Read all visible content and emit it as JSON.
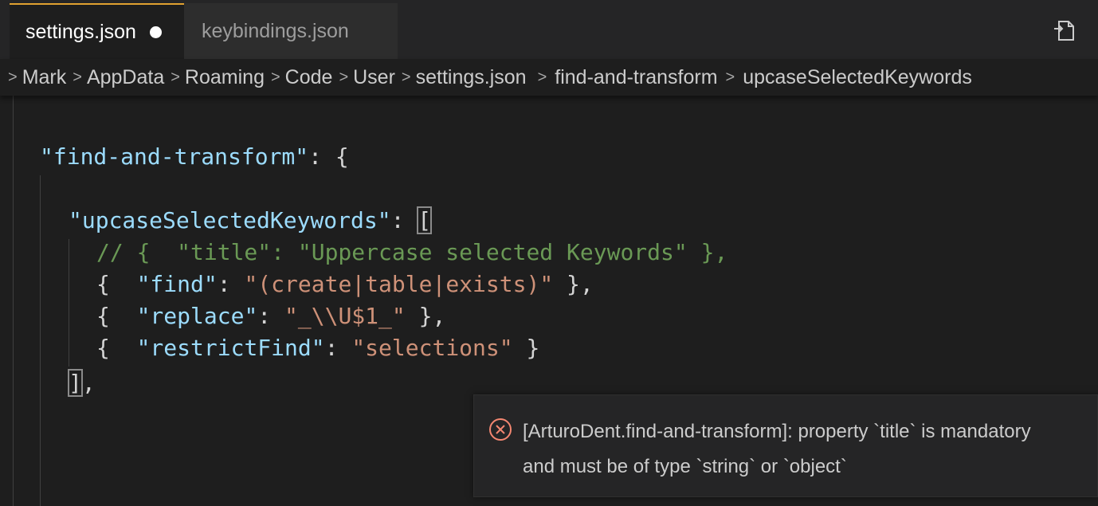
{
  "tabs": [
    {
      "label": "settings.json",
      "active": true,
      "dirty": true
    },
    {
      "label": "keybindings.json",
      "active": false,
      "dirty": false
    }
  ],
  "icons": {
    "open_changes": "open-changes-icon",
    "separator": "chevron-right-icon",
    "error": "error-circle-x-icon",
    "dirty": "unsaved-dot-icon"
  },
  "breadcrumbs": [
    "Mark",
    "AppData",
    "Roaming",
    "Code",
    "User",
    "settings.json",
    "find-and-transform",
    "upcaseSelectedKeywords"
  ],
  "editor": {
    "lines": {
      "l1_key": "\"find-and-transform\"",
      "l1_rest": ": {",
      "l2_key": "\"upcaseSelectedKeywords\"",
      "l2_colon": ": ",
      "l2_bracket": "[",
      "l3_comment": "// {  \"title\": \"Uppercase selected Keywords\" },",
      "l4_open": "{  ",
      "l4_key": "\"find\"",
      "l4_colon": ": ",
      "l4_val": "\"(create|table|exists)\"",
      "l4_close": " },",
      "l5_open": "{  ",
      "l5_key": "\"replace\"",
      "l5_colon": ": ",
      "l5_val": "\"_\\\\U$1_\"",
      "l5_close": " },",
      "l6_open": "{  ",
      "l6_key": "\"restrictFind\"",
      "l6_colon": ": ",
      "l6_val": "\"selections\"",
      "l6_close": " }",
      "l7_bracket": "]",
      "l7_rest": ","
    }
  },
  "hover": {
    "line1": "[ArturoDent.find-and-transform]: property `title` is mandatory",
    "line2": "and must be of type `string` or `object`"
  },
  "colors": {
    "editor_bg": "#1e1e1e",
    "active_tab_border": "#e1a230",
    "key": "#9cdcfe",
    "string": "#ce9178",
    "comment": "#6a9955",
    "error": "#f48771"
  }
}
